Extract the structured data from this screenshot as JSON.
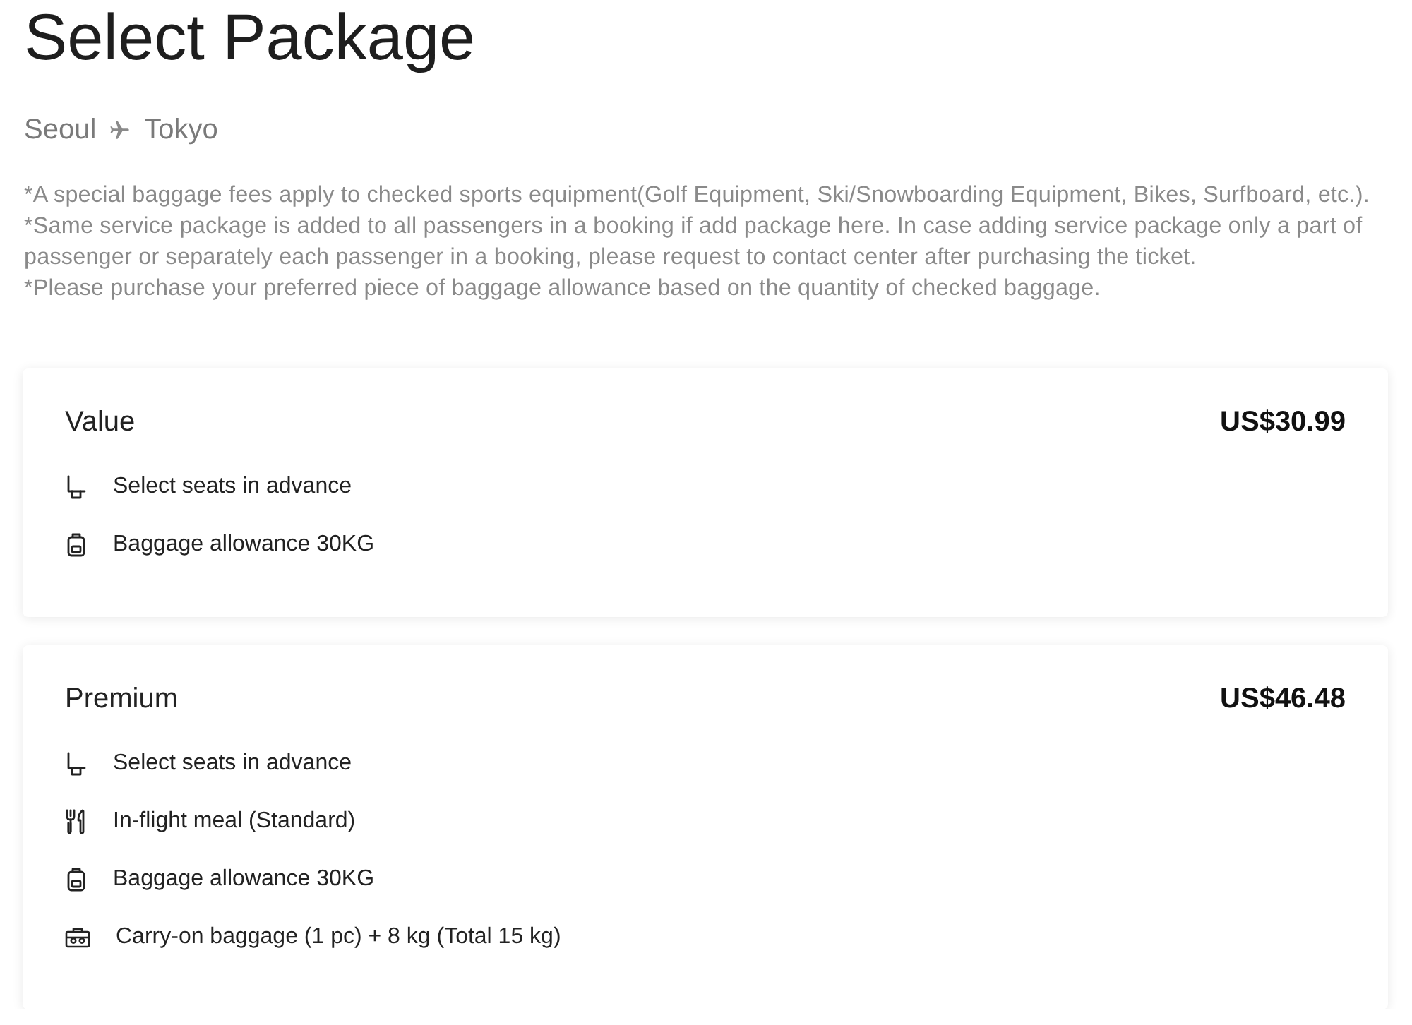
{
  "page": {
    "title": "Select Package"
  },
  "route": {
    "origin": "Seoul",
    "destination": "Tokyo"
  },
  "notes": [
    "*A special baggage fees apply to checked sports equipment(Golf Equipment, Ski/Snowboarding Equipment, Bikes, Surfboard, etc.).",
    "*Same service package is added to all passengers in a booking if add package here. In case adding service package only a part of passenger or separately each passenger in a booking, please request to contact center after purchasing the ticket.",
    "*Please purchase your preferred piece of baggage allowance based on the quantity of checked baggage."
  ],
  "packages": [
    {
      "name": "Value",
      "price": "US$30.99",
      "features": [
        {
          "kind": "seat",
          "label": "Select seats in advance"
        },
        {
          "kind": "baggage",
          "label": "Baggage allowance 30KG"
        }
      ]
    },
    {
      "name": "Premium",
      "price": "US$46.48",
      "features": [
        {
          "kind": "seat",
          "label": "Select seats in advance"
        },
        {
          "kind": "meal",
          "label": "In-flight meal (Standard)"
        },
        {
          "kind": "baggage",
          "label": "Baggage allowance 30KG"
        },
        {
          "kind": "carry-on",
          "label": "Carry-on baggage (1 pc) + 8 kg (Total 15 kg)"
        }
      ]
    }
  ]
}
